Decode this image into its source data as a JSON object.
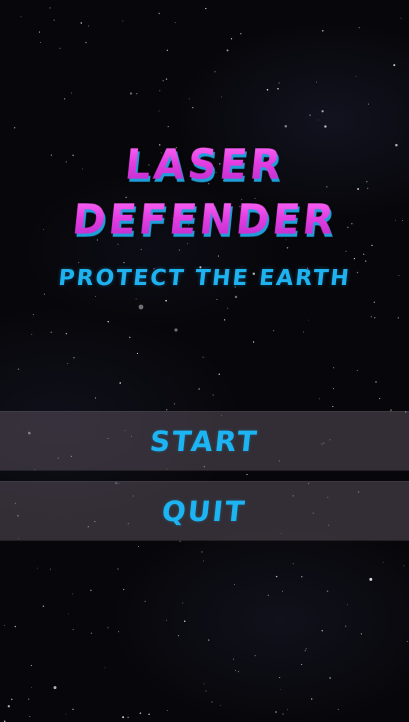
{
  "title": {
    "line1": "LASER",
    "line2": "DEFENDER"
  },
  "subtitle": "PROTECT THE EARTH",
  "menu": {
    "start_label": "START",
    "quit_label": "QUIT"
  },
  "colors": {
    "title_magenta": "#e23fe6",
    "title_shadow_cyan": "#1e9fd8",
    "accent_cyan": "#1cb4f2",
    "button_bg": "#584e5a",
    "space_bg": "#07070b"
  }
}
